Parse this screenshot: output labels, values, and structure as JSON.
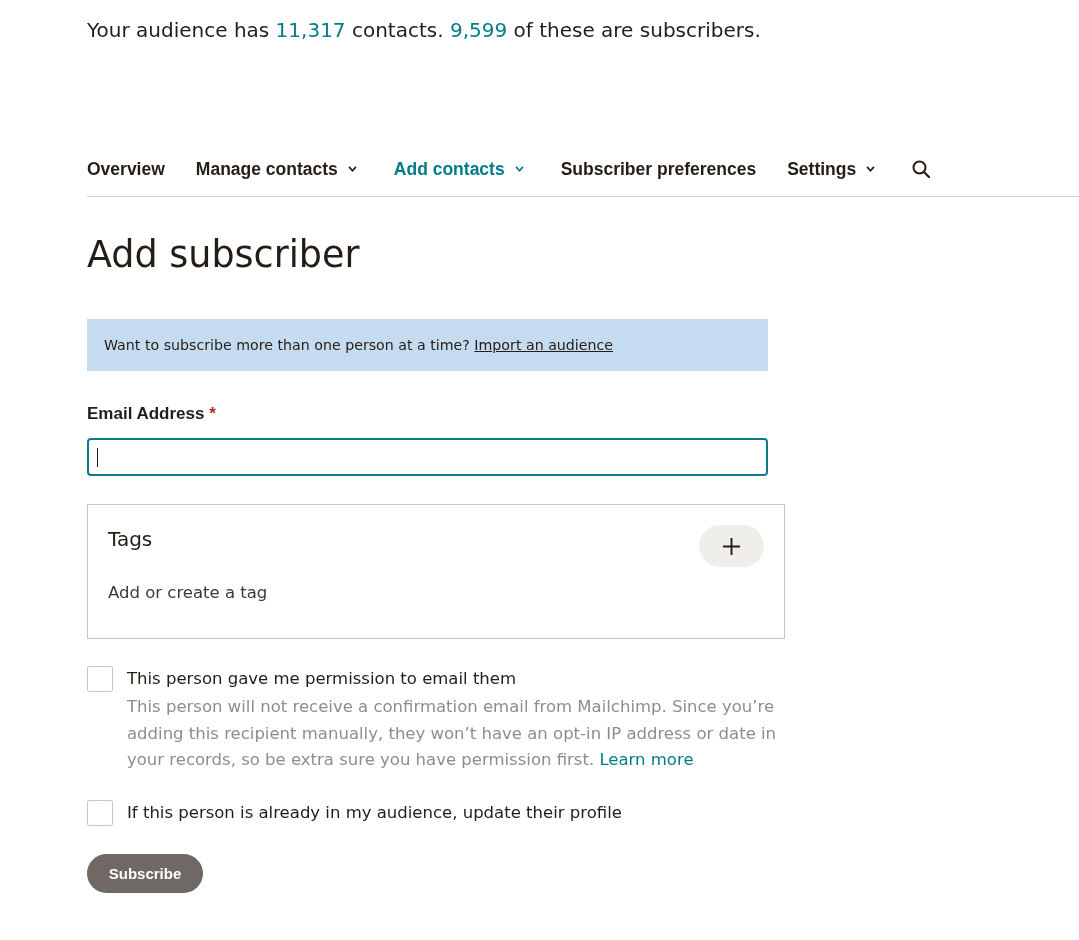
{
  "summary": {
    "segments": [
      {
        "text": "Your audience has ",
        "highlight": false
      },
      {
        "text": "11,317",
        "highlight": true
      },
      {
        "text": " contacts. ",
        "highlight": false
      },
      {
        "text": "9,599",
        "highlight": true
      },
      {
        "text": " of these are subscribers.",
        "highlight": false
      }
    ]
  },
  "nav": {
    "items": [
      {
        "label": "Overview",
        "kind": "link",
        "selected": false
      },
      {
        "label": "Manage contacts",
        "kind": "dropdown",
        "selected": false
      },
      {
        "label": "Add contacts",
        "kind": "dropdown",
        "selected": true
      },
      {
        "label": "Subscriber preferences",
        "kind": "link",
        "selected": false
      },
      {
        "label": "Settings",
        "kind": "dropdown",
        "selected": false
      }
    ]
  },
  "page_title": "Add subscriber",
  "banner": {
    "text": "Want to subscribe more than one person at a time?",
    "link": "Import an audience"
  },
  "email_field": {
    "label": "Email Address",
    "required_mark": "*",
    "focused": true
  },
  "tags": {
    "title": "Tags",
    "hint": "Add or create a tag"
  },
  "options": [
    {
      "label": "This person gave me permission to email them",
      "checked": false,
      "description": "This person will not receive a confirmation email from Mailchimp. Since you’re adding this recipient manually, they won’t have an opt-in IP address or date in your records, so be extra sure you have permission first.",
      "link": "Learn more"
    },
    {
      "label": "If this person is already in my audience, update their profile",
      "checked": false
    }
  ],
  "submit_button": "Subscribe"
}
